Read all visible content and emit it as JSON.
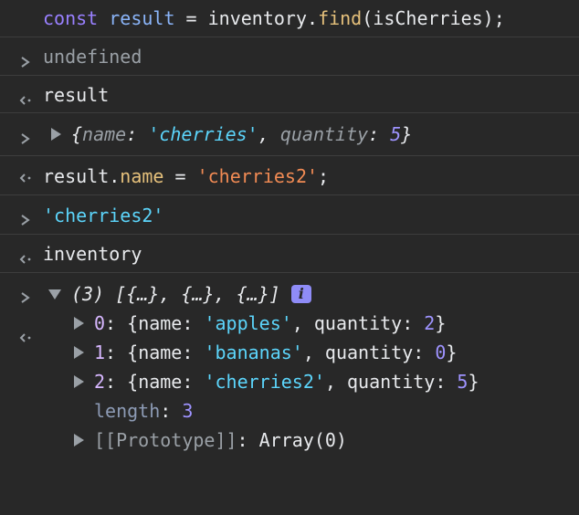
{
  "console": {
    "entries": [
      {
        "type": "input",
        "code": {
          "kw": "const",
          "var": "result",
          "op": " = ",
          "obj": "inventory.",
          "fn": "find",
          "args": "(isCherries);"
        }
      },
      {
        "type": "output",
        "value": "undefined"
      },
      {
        "type": "input",
        "text": "result"
      },
      {
        "type": "output-object",
        "preview": {
          "open": "{",
          "k1": "name",
          "v1": "'cherries'",
          "k2": "quantity",
          "v2": "5",
          "close": "}"
        }
      },
      {
        "type": "input",
        "code": {
          "obj": "result.",
          "prop": "name",
          "op": " = ",
          "str": "'cherries2'",
          "end": ";"
        }
      },
      {
        "type": "output",
        "value": "'cherries2'"
      },
      {
        "type": "input",
        "text": "inventory"
      },
      {
        "type": "output-array",
        "summary": "(3) [{…}, {…}, {…}]",
        "info_icon": "i",
        "items": [
          {
            "index": "0",
            "name": "'apples'",
            "quantity": "2"
          },
          {
            "index": "1",
            "name": "'bananas'",
            "quantity": "0"
          },
          {
            "index": "2",
            "name": "'cherries2'",
            "quantity": "5"
          }
        ],
        "length_label": "length",
        "length_value": "3",
        "prototype_label": "[[Prototype]]",
        "prototype_value": "Array(0)"
      }
    ],
    "labels": {
      "name_key": "name",
      "quantity_key": "quantity",
      "colon": ": ",
      "comma": ", "
    }
  }
}
